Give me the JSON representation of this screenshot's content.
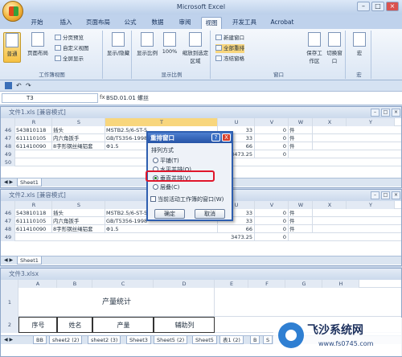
{
  "app_title": "Microsoft Excel",
  "ribbon_tabs": [
    "开始",
    "插入",
    "页面布局",
    "公式",
    "数据",
    "审阅",
    "视图",
    "开发工具",
    "Acrobat"
  ],
  "active_tab": "视图",
  "ribbon": {
    "workbook_views": {
      "label": "工作簿视图",
      "normal": "普通",
      "page_layout": "页面布局",
      "page_break": "分页预览",
      "custom": "自定义视图",
      "fullscreen": "全屏显示"
    },
    "show_hide": {
      "label": "显示/隐藏"
    },
    "zoom": {
      "label": "显示比例",
      "zoom": "显示比例",
      "hundred": "100%",
      "fit": "缩放到选定区域"
    },
    "window": {
      "label": "窗口",
      "new": "新建窗口",
      "arrange": "全部重排",
      "freeze": "冻结窗格",
      "save_ws": "保存工作区",
      "switch": "切换窗口"
    },
    "macro": {
      "label": "宏",
      "macro": "宏"
    }
  },
  "formula_bar": {
    "name_box": "T3",
    "fx": "fx",
    "content": "BSD.01.01 螺丝"
  },
  "win1": {
    "title": "文件1.xls  [兼容模式]",
    "cols": [
      "R",
      "S",
      "T",
      "U",
      "V",
      "W",
      "X",
      "Y"
    ],
    "rows": [
      {
        "n": "46",
        "r": "543810118",
        "s": "插头",
        "t": "MSTB2.5/6-ST-5",
        "u": "33",
        "v": "0",
        "w": "件"
      },
      {
        "n": "47",
        "r": "611110105",
        "s": "内六角扳手",
        "t": "GB/T5356-1998",
        "u": "33",
        "v": "0",
        "w": "件"
      },
      {
        "n": "48",
        "r": "611410090",
        "s": "8字形钢丝绳铝套",
        "t": "Φ1.5",
        "u": "66",
        "v": "0",
        "w": "件"
      },
      {
        "n": "49",
        "r": "",
        "s": "",
        "t": "",
        "u": "3473.25",
        "v": "0",
        "w": ""
      },
      {
        "n": "50",
        "r": "",
        "s": "",
        "t": "",
        "u": "",
        "v": "",
        "w": ""
      }
    ],
    "sheet": "Sheet1"
  },
  "win2": {
    "title": "文件2.xls  [兼容模式]",
    "cols": [
      "R",
      "S",
      "T",
      "U",
      "V",
      "W",
      "X",
      "Y"
    ],
    "rows": [
      {
        "n": "46",
        "r": "543810118",
        "s": "插头",
        "t": "MSTB2.5/6-ST-5",
        "u": "33",
        "v": "0",
        "w": "件"
      },
      {
        "n": "47",
        "r": "611110105",
        "s": "内六角扳手",
        "t": "GB/T5356-1998",
        "u": "33",
        "v": "0",
        "w": "件"
      },
      {
        "n": "48",
        "r": "611410090",
        "s": "8字形钢丝绳铝套",
        "t": "Φ1.5",
        "u": "66",
        "v": "0",
        "w": "件"
      },
      {
        "n": "49",
        "r": "",
        "s": "",
        "t": "",
        "u": "3473.25",
        "v": "0",
        "w": ""
      }
    ],
    "sheet": "Sheet1"
  },
  "win3": {
    "title": "文件3.xlsx",
    "cols": [
      "A",
      "B",
      "C",
      "D",
      "E",
      "F",
      "G",
      "H"
    ],
    "heading": "产量统计",
    "row2": [
      "序号",
      "姓名",
      "产量",
      "辅助列"
    ],
    "sheets": [
      "BB",
      "sheet2 (2)",
      "sheet2 (3)",
      "Sheet3",
      "Sheet5 (2)",
      "Sheet5",
      "表1 (2)",
      "B",
      "S"
    ]
  },
  "dialog": {
    "title": "重排窗口",
    "section": "排列方式",
    "tiled": "平铺(T)",
    "horizontal": "水平并排(O)",
    "vertical": "垂直并排(V)",
    "cascade": "层叠(C)",
    "active_only": "当前活动工作簿的窗口(W)",
    "ok": "确定",
    "cancel": "取消",
    "help": "?",
    "close": "X"
  },
  "watermark": {
    "name": "飞沙系统网",
    "url": "www.fs0745.com"
  }
}
